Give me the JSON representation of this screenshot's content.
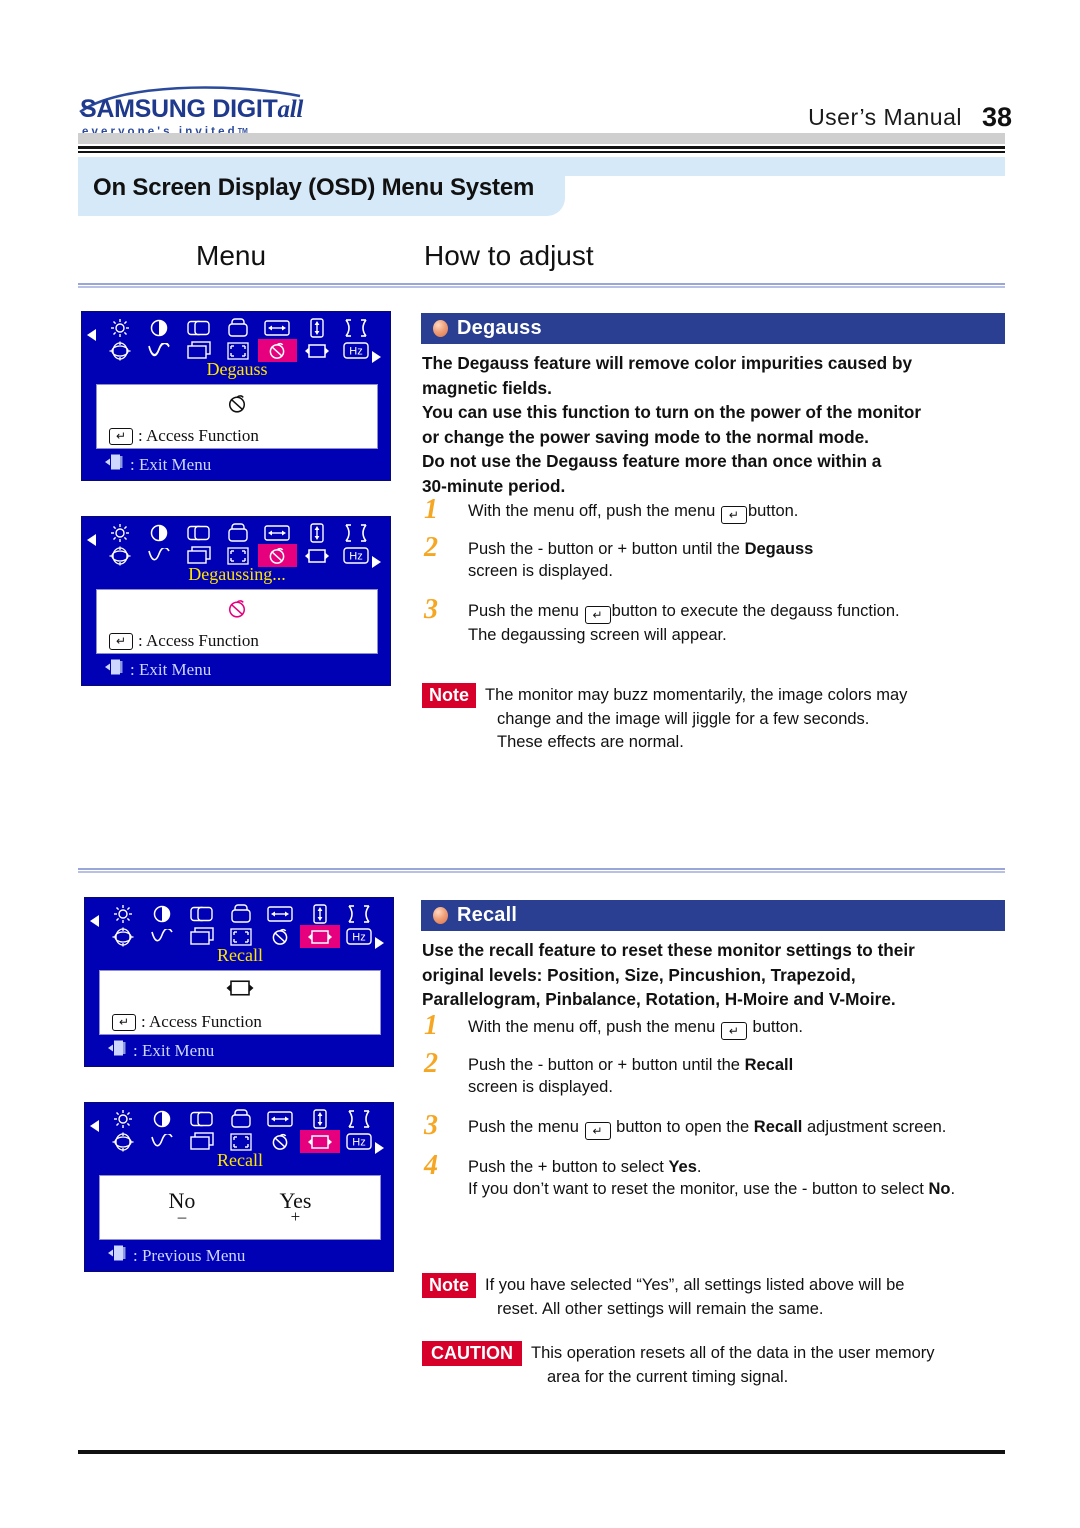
{
  "header": {
    "logo_main": "SAMSUNG DIGIT",
    "logo_main_italic": "all",
    "logo_sub": "everyone's invited",
    "logo_tm": "TM",
    "manual_label": "User’s Manual",
    "page_number": "38"
  },
  "page_title": "On Screen Display (OSD) Menu System",
  "columns": {
    "menu": "Menu",
    "how_to_adjust": "How to adjust"
  },
  "osd_panels": [
    {
      "name": "degauss-menu",
      "label": "Degauss",
      "label_color": "#ffe600",
      "highlight_index": 11,
      "body_icon": "degauss-icon",
      "body_icon_color": "#111111",
      "access_label": ": Access Function",
      "exit_label": ": Exit Menu"
    },
    {
      "name": "degaussing-progress",
      "label": "Degaussing...",
      "label_color": "#ffe600",
      "highlight_index": 11,
      "body_icon": "degauss-icon",
      "body_icon_color": "#e6007e",
      "access_label": ": Access Function",
      "exit_label": ": Exit Menu"
    },
    {
      "name": "recall-menu",
      "label": "Recall",
      "label_color": "#ffe600",
      "highlight_index": 12,
      "body_icon": "recall-icon",
      "body_icon_color": "#111111",
      "access_label": ": Access Function",
      "exit_label": ": Exit Menu"
    },
    {
      "name": "recall-confirm",
      "label": "Recall",
      "label_color": "#ffe600",
      "highlight_index": 12,
      "options": [
        {
          "text": "No",
          "sign": "–"
        },
        {
          "text": "Yes",
          "sign": "+"
        }
      ],
      "exit_label": ": Previous Menu"
    }
  ],
  "osd_icons": [
    "brightness-icon",
    "contrast-icon",
    "h-position-icon",
    "v-position-icon",
    "h-size-icon",
    "v-size-icon",
    "pincushion-icon",
    "rotation-icon",
    "pinbalance-icon",
    "trapezoid-icon",
    "parallelogram-icon",
    "degauss-icon",
    "recall-icon",
    "hz-icon"
  ],
  "degauss_section": {
    "heading": "Degauss",
    "lead": [
      "The Degauss feature will remove color impurities caused by",
      "magnetic fields.",
      "You can use this function to turn on the power of the monitor",
      "or change the power saving mode to the normal mode.",
      "Do not use the Degauss feature more than once within a",
      "30-minute period."
    ],
    "steps": [
      {
        "num": "1",
        "before": "With the menu off, push the menu ",
        "key": "↵",
        "after": "button.",
        "line2": ""
      },
      {
        "num": "2",
        "before": "Push the - button or  + button until the ",
        "bold": "Degauss",
        "after": "",
        "line2": "screen is displayed."
      },
      {
        "num": "3",
        "before": "Push the menu ",
        "key": "↵",
        "after": "button to execute the degauss function.",
        "line2": "The degaussing screen will appear."
      }
    ],
    "note": {
      "tag": "Note",
      "line1": "The monitor may buzz momentarily, the image colors may",
      "line2": "change and the image will jiggle for a few seconds.",
      "line3": "These effects are normal."
    }
  },
  "recall_section": {
    "heading": "Recall",
    "lead": [
      "Use the recall feature to reset these monitor settings to their",
      "original levels: Position, Size, Pincushion, Trapezoid,",
      "Parallelogram, Pinbalance, Rotation, H-Moire and V-Moire."
    ],
    "steps": [
      {
        "num": "1",
        "before": "With the menu off, push the menu ",
        "key": "↵",
        "after": " button.",
        "line2": ""
      },
      {
        "num": "2",
        "before": "Push the - button or  + button until the ",
        "bold": "Recall",
        "after": "",
        "line2": "screen is displayed."
      },
      {
        "num": "3",
        "before": "Push the menu ",
        "key": "↵",
        "after_bold_pre": " button to open the ",
        "bold": "Recall",
        "after": " adjustment screen.",
        "line2": ""
      },
      {
        "num": "4",
        "before": "Push the + button to select ",
        "bold": "Yes",
        "after": ".",
        "line2_pre": "If you don’t want to reset the monitor, use the - button to select ",
        "line2_bold": "No",
        "line2_post": "."
      }
    ],
    "note": {
      "tag": "Note",
      "line1": "If you have selected “Yes”, all settings listed above will be",
      "line2": "reset. All other settings will remain the same."
    },
    "caution": {
      "tag": "CAUTION",
      "line1": "This operation resets all of the data in the user memory",
      "line2": "area for the current timing signal."
    }
  },
  "colors": {
    "osd_blue": "#0000b4",
    "highlight_magenta": "#e6007e",
    "section_header_blue": "#2a3f91",
    "note_red": "#d6002a",
    "step_number_orange": "#f5a623",
    "title_band_blue": "#d6e9f8",
    "logo_blue": "#1f3a8c"
  }
}
